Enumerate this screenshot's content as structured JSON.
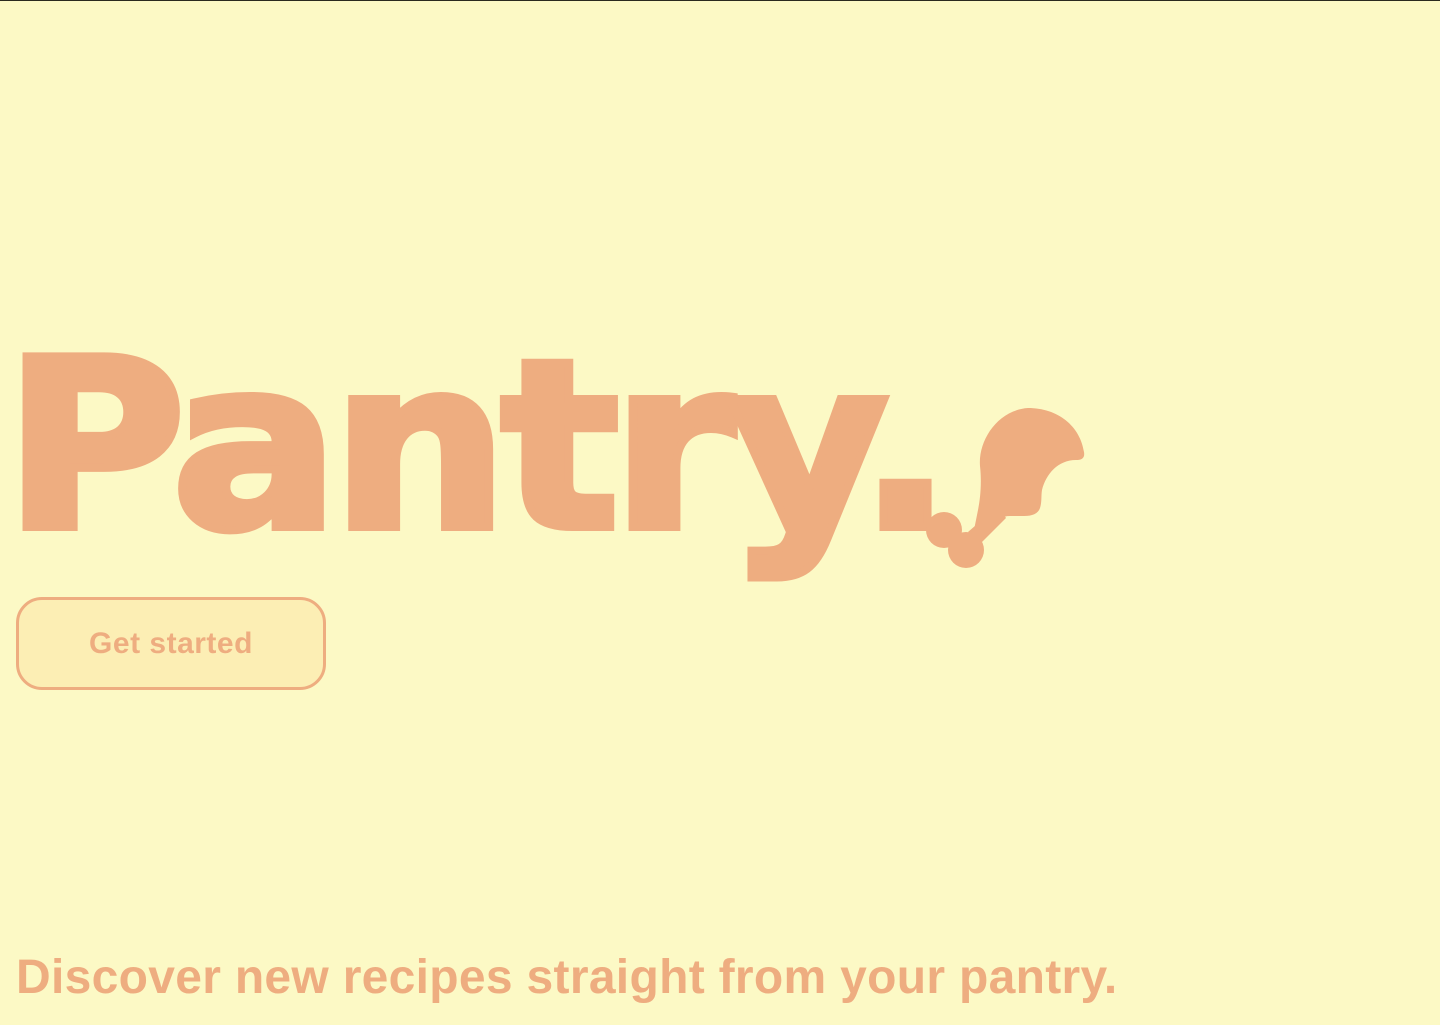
{
  "brand": {
    "name": "Pantry.",
    "logo_icon": "drumstick-icon"
  },
  "hero": {
    "cta_label": "Get started",
    "tagline": "Discover new recipes straight from your pantry."
  },
  "colors": {
    "background": "#FCF9C5",
    "accent": "#EEAD80",
    "button_fill": "#FCEEB4"
  }
}
